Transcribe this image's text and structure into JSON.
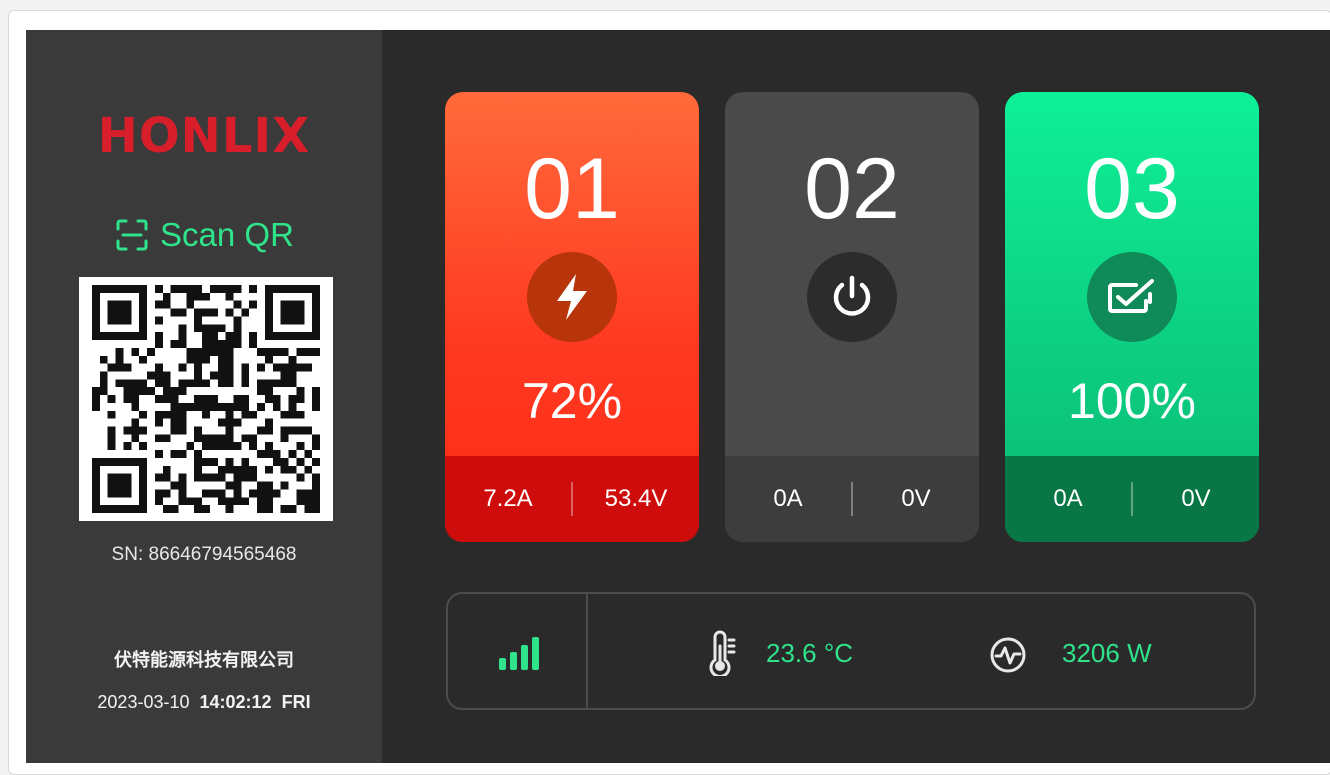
{
  "brand": {
    "logo_text": "HONLIX"
  },
  "sidebar": {
    "scan_label": "Scan QR",
    "sn_label": "SN:",
    "sn_value": "86646794565468",
    "company": "伏特能源科技有限公司",
    "date": "2023-03-10",
    "time": "14:02:12",
    "weekday": "FRI"
  },
  "chargers": [
    {
      "number": "01",
      "state_icon": "lightning-icon",
      "percent": "72%",
      "current": "7.2A",
      "voltage": "53.4V",
      "accent": "#ff3a22"
    },
    {
      "number": "02",
      "state_icon": "power-icon",
      "percent": "",
      "current": "0A",
      "voltage": "0V",
      "accent": "#4a4a4a"
    },
    {
      "number": "03",
      "state_icon": "battery-check-icon",
      "percent": "100%",
      "current": "0A",
      "voltage": "0V",
      "accent": "#0dd082"
    }
  ],
  "status_bar": {
    "signal_icon": "signal-icon",
    "temperature": "23.6 °C",
    "power": "3206 W",
    "value_color": "#2fe38a"
  }
}
